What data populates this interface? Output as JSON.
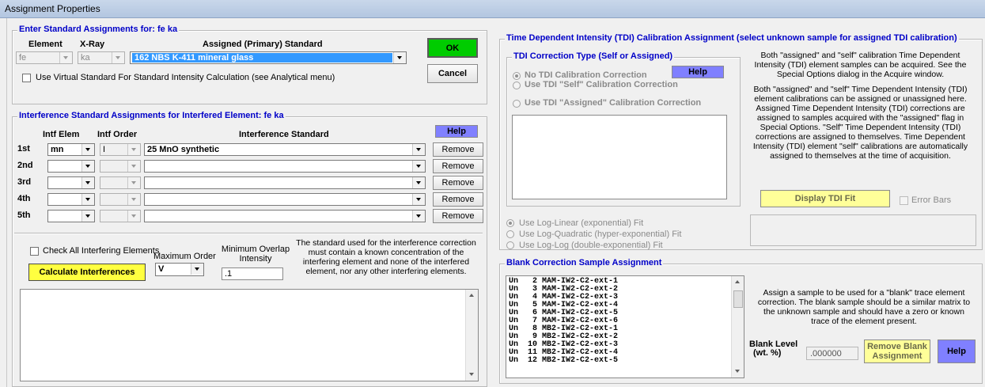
{
  "window": {
    "title": "Assignment Properties"
  },
  "std": {
    "legend": "Enter Standard Assignments for:  fe ka",
    "col_element": "Element",
    "col_xray": "X-Ray",
    "col_assigned": "Assigned (Primary) Standard",
    "element": "fe",
    "xray": "ka",
    "standard": "162 NBS K-411 mineral glass",
    "virtual_label": "Use Virtual Standard For Standard Intensity Calculation (see Analytical menu)",
    "virtual_checked": false
  },
  "buttons": {
    "ok": "OK",
    "cancel": "Cancel"
  },
  "interf": {
    "legend": "Interference Standard Assignments for Interfered Element:  fe ka",
    "help": "Help",
    "col_elem": "Intf Elem",
    "col_order": "Intf Order",
    "col_std": "Interference Standard",
    "remove": "Remove",
    "rows": [
      {
        "label": "1st",
        "elem": "mn",
        "order": "I",
        "std": "25 MnO synthetic"
      },
      {
        "label": "2nd",
        "elem": "",
        "order": "",
        "std": ""
      },
      {
        "label": "3rd",
        "elem": "",
        "order": "",
        "std": ""
      },
      {
        "label": "4th",
        "elem": "",
        "order": "",
        "std": ""
      },
      {
        "label": "5th",
        "elem": "",
        "order": "",
        "std": ""
      }
    ],
    "check_all": "Check All Interfering Elements",
    "max_order_label": "Maximum Order",
    "max_order": "V",
    "min_overlap_label": "Minimum Overlap Intensity",
    "min_overlap": ".1",
    "note": "The standard used for the interference correction must contain a known concentration of the interfering element and none of the interfered element, nor any other interfering elements.",
    "calculate": "Calculate Interferences"
  },
  "tdi": {
    "legend": "Time Dependent Intensity (TDI) Calibration Assignment (select unknown sample for assigned TDI calibration)",
    "type_legend": "TDI Correction Type (Self or Assigned)",
    "help": "Help",
    "options": [
      "No TDI Calibration Correction",
      "Use TDI \"Self\" Calibration Correction",
      "Use TDI \"Assigned\" Calibration Correction"
    ],
    "note1": "Both \"assigned\" and \"self\" calibration Time Dependent Intensity (TDI) element samples can be acquired. See the Special Options dialog in the Acquire window.",
    "note2": "Both \"assigned\" and \"self\" Time Dependent Intensity (TDI) element calibrations can be assigned or unassigned here. Assigned Time Dependent Intensity (TDI) corrections are assigned to samples acquired with the \"assigned\" flag in Special Options. \"Self\" Time Dependent Intensity (TDI) corrections are assigned to themselves. Time Dependent Intensity (TDI) element \"self\" calibrations are automatically assigned to themselves at the time of acquisition.",
    "display_fit": "Display TDI Fit",
    "error_bars": "Error Bars",
    "fits": [
      "Use Log-Linear (exponential) Fit",
      "Use Log-Quadratic (hyper-exponential) Fit",
      "Use Log-Log (double-exponential) Fit"
    ]
  },
  "blank": {
    "legend": "Blank Correction Sample Assignment",
    "items": [
      "Un   2 MAM-IW2-C2-ext-1",
      "Un   3 MAM-IW2-C2-ext-2",
      "Un   4 MAM-IW2-C2-ext-3",
      "Un   5 MAM-IW2-C2-ext-4",
      "Un   6 MAM-IW2-C2-ext-5",
      "Un   7 MAM-IW2-C2-ext-6",
      "Un   8 MB2-IW2-C2-ext-1",
      "Un   9 MB2-IW2-C2-ext-2",
      "Un  10 MB2-IW2-C2-ext-3",
      "Un  11 MB2-IW2-C2-ext-4",
      "Un  12 MB2-IW2-C2-ext-5"
    ],
    "note": "Assign a sample to be used for a \"blank\" trace element correction.  The blank sample should be a similar matrix to the unknown sample and should have a zero or known trace of the element present.",
    "level_label": "Blank Level",
    "level_unit": "(wt. %)",
    "level_value": ".000000",
    "remove": "Remove Blank Assignment",
    "help": "Help"
  }
}
